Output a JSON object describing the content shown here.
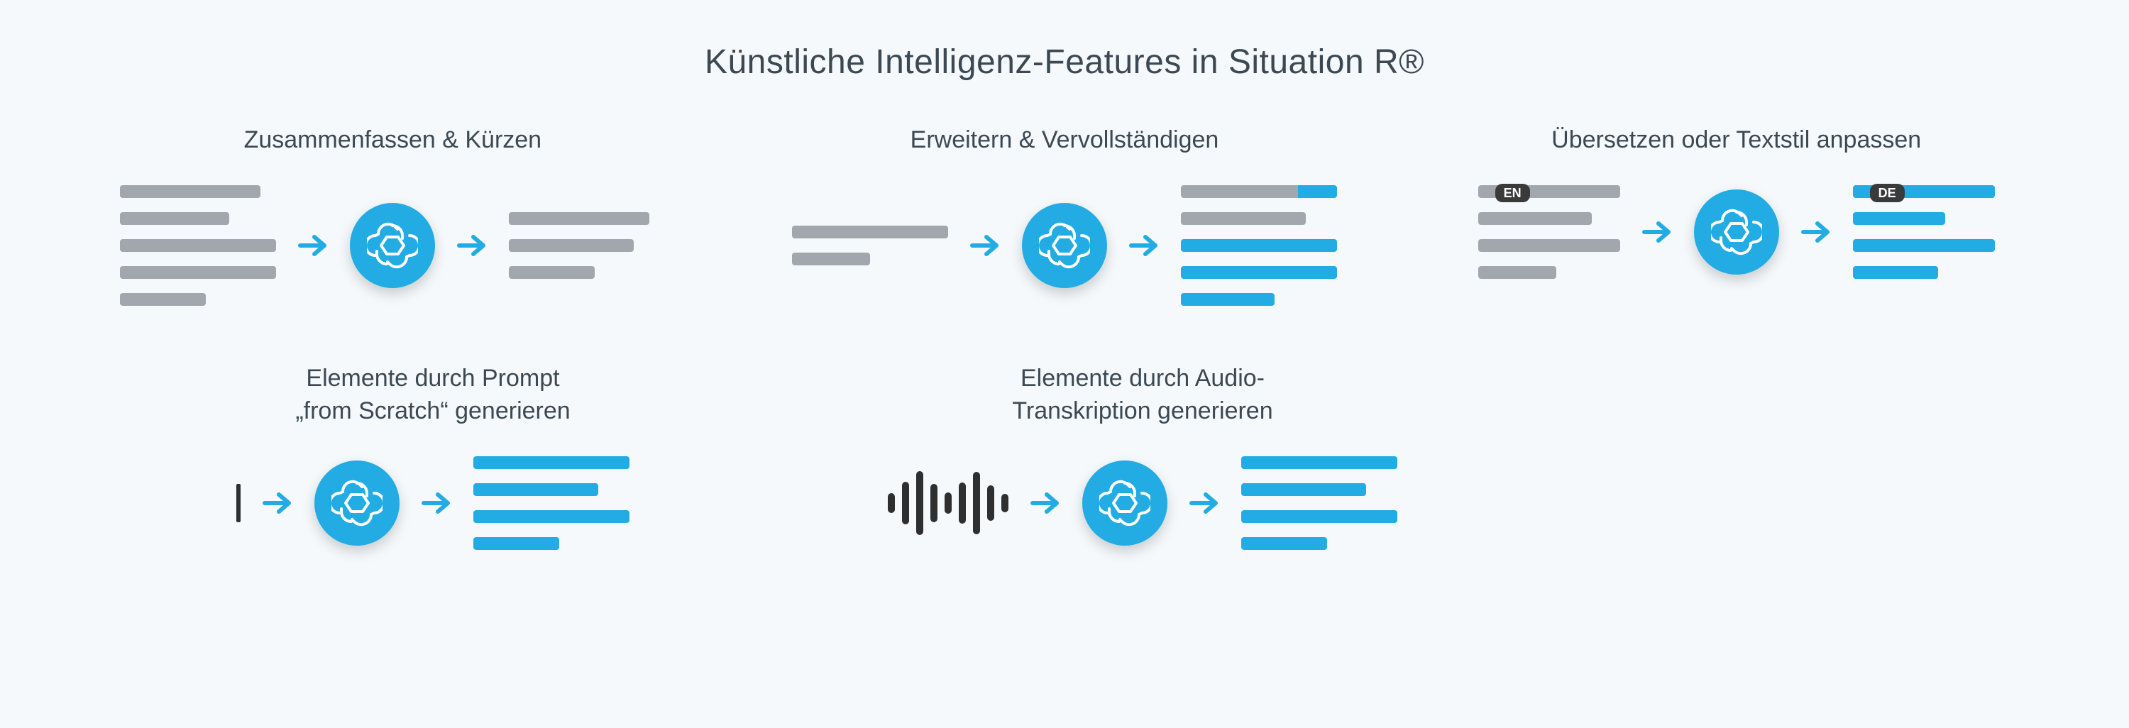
{
  "title": "Künstliche Intelligenz-Features in Situation R®",
  "features": {
    "summarize": {
      "label": "Zusammenfassen & Kürzen"
    },
    "expand": {
      "label": "Erweitern & Vervollständigen"
    },
    "translate": {
      "label": "Übersetzen oder Textstil anpassen",
      "src_lang_badge": "EN",
      "dst_lang_badge": "DE"
    },
    "prompt": {
      "label": "Elemente durch Prompt\n„from Scratch“ generieren"
    },
    "audio": {
      "label": "Elemente durch Audio-\nTranskription generieren"
    }
  },
  "icons": {
    "arrow": "arrow-right",
    "ai_knot": "openai-knot",
    "prompt_cursor": "text-cursor",
    "audio_wave": "audio-waveform"
  },
  "colors": {
    "background": "#f5f9fb",
    "text": "#3c4852",
    "grey": "#a1a7ac",
    "accent_blue": "#22ace3",
    "dark": "#2f2f2f"
  }
}
